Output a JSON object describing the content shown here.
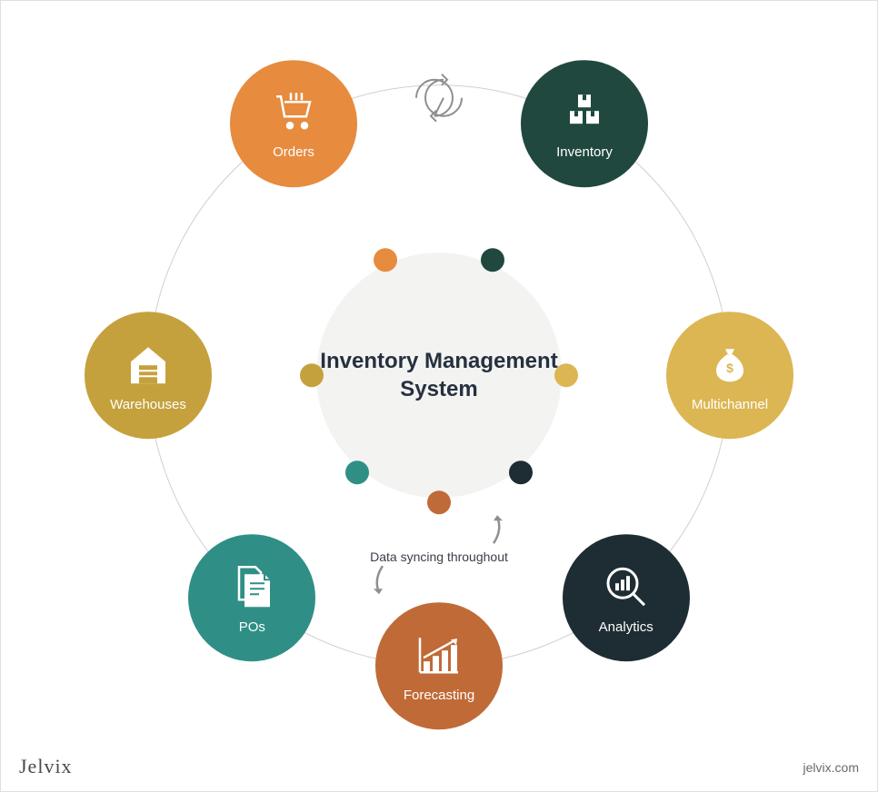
{
  "center": {
    "title": "Inventory Management System"
  },
  "nodes": [
    {
      "id": "orders",
      "label": "Orders",
      "icon": "cart",
      "color": "#e78b3f"
    },
    {
      "id": "inventory",
      "label": "Inventory",
      "icon": "boxes",
      "color": "#20483f"
    },
    {
      "id": "multichannel",
      "label": "Multichannel",
      "icon": "moneybag",
      "color": "#dcb653"
    },
    {
      "id": "analytics",
      "label": "Analytics",
      "icon": "analytics",
      "color": "#1e2d33"
    },
    {
      "id": "forecasting",
      "label": "Forecasting",
      "icon": "chart-up",
      "color": "#c06a37"
    },
    {
      "id": "pos",
      "label": "POs",
      "icon": "documents",
      "color": "#2f8f86"
    },
    {
      "id": "warehouses",
      "label": "Warehouses",
      "icon": "warehouse",
      "color": "#c5a13d"
    }
  ],
  "small_dots": [
    {
      "color": "#e78b3f"
    },
    {
      "color": "#20483f"
    },
    {
      "color": "#dcb653"
    },
    {
      "color": "#1e2d33"
    },
    {
      "color": "#c06a37"
    },
    {
      "color": "#2f8f86"
    },
    {
      "color": "#c5a13d"
    }
  ],
  "sync_caption": "Data syncing throughout",
  "brand": {
    "name": "Jelvix",
    "url": "jelvix.com"
  }
}
